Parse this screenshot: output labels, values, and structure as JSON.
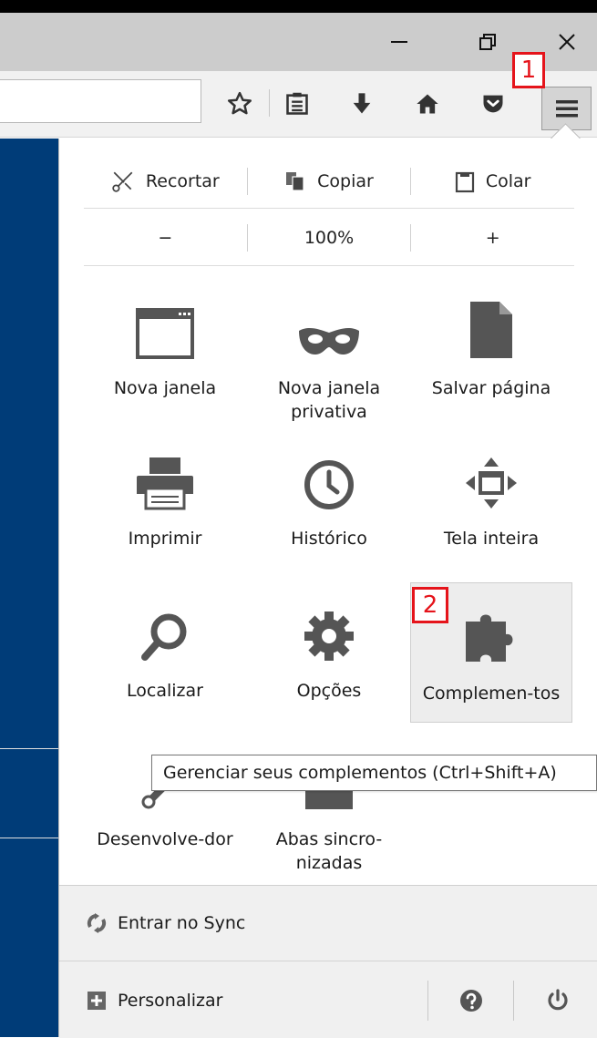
{
  "window": {
    "minimize_icon": "minimize-icon",
    "restore_icon": "restore-icon",
    "close_icon": "close-icon"
  },
  "toolbar": {
    "icons": [
      "bookmark-star-icon",
      "reading-list-icon",
      "download-arrow-icon",
      "home-icon",
      "pocket-icon",
      "hamburger-menu-icon"
    ]
  },
  "annotations": {
    "step1": "1",
    "step2": "2",
    "color": "#e5141b"
  },
  "edit": {
    "cut": "Recortar",
    "copy": "Copiar",
    "paste": "Colar"
  },
  "zoom": {
    "out": "−",
    "level": "100%",
    "in": "+"
  },
  "menu": {
    "items": [
      {
        "label": "Nova janela",
        "icon": "new-window-icon"
      },
      {
        "label": "Nova janela privativa",
        "icon": "private-mask-icon"
      },
      {
        "label": "Salvar página",
        "icon": "save-page-icon"
      },
      {
        "label": "Imprimir",
        "icon": "printer-icon"
      },
      {
        "label": "Histórico",
        "icon": "history-clock-icon"
      },
      {
        "label": "Tela inteira",
        "icon": "fullscreen-icon"
      },
      {
        "label": "Localizar",
        "icon": "search-icon"
      },
      {
        "label": "Opções",
        "icon": "gear-icon"
      },
      {
        "label": "Complemen-tos",
        "icon": "puzzle-icon"
      },
      {
        "label": "Desenvolve-dor",
        "icon": "wrench-icon"
      },
      {
        "label": "Abas sincro-nizadas",
        "icon": "synced-tabs-icon"
      }
    ]
  },
  "tooltip": {
    "text": "Gerenciar seus complementos (Ctrl+Shift+A)"
  },
  "footer": {
    "sync_label": "Entrar no Sync",
    "customize_label": "Personalizar",
    "help_icon": "help-icon",
    "quit_icon": "power-icon"
  },
  "colors": {
    "sidebar": "#003c78",
    "icon_gray": "#555555",
    "highlight": "#ededed"
  }
}
